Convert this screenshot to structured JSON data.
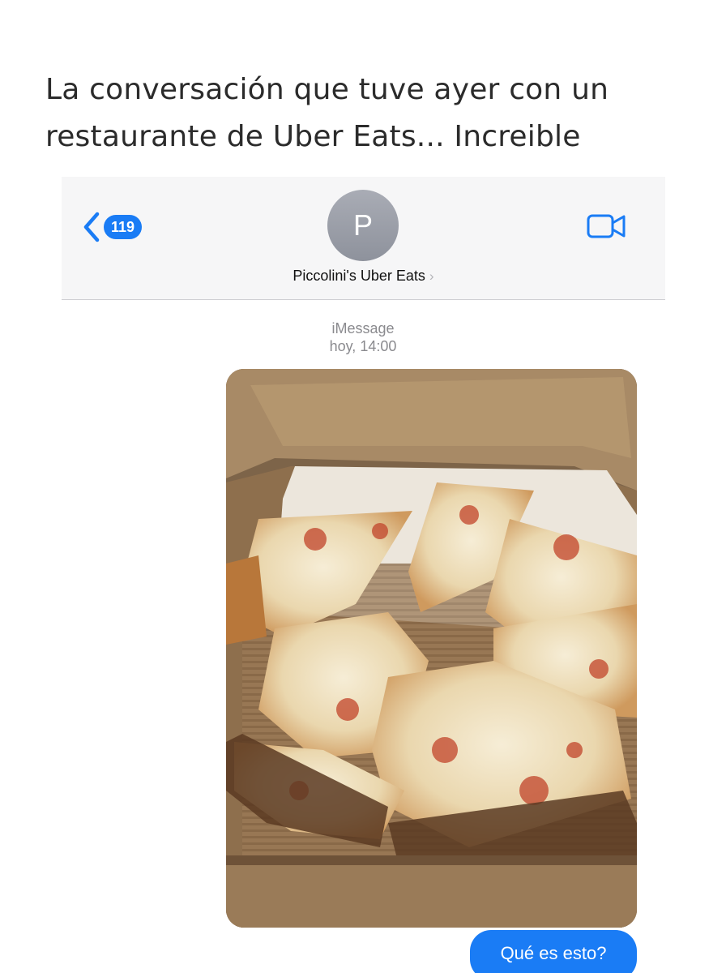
{
  "caption": {
    "line1": "La conversación que tuve ayer con un",
    "line2": "restaurante de Uber Eats... Increible"
  },
  "header": {
    "back_count": "119",
    "avatar_initial": "P",
    "contact_name": "Piccolini's Uber Eats",
    "chevron": "›"
  },
  "thread": {
    "service": "iMessage",
    "timestamp": "hoy, 14:00",
    "messages": [
      {
        "type": "image",
        "description_icon": "pizza-photo"
      },
      {
        "type": "text",
        "text": "Qué es esto?"
      }
    ]
  },
  "colors": {
    "accent": "#1a7cf5",
    "header_bg": "#f6f6f7",
    "meta_text": "#8a8a8e"
  },
  "icons": [
    "back-chevron-icon",
    "video-camera-icon",
    "contact-chevron-icon"
  ]
}
